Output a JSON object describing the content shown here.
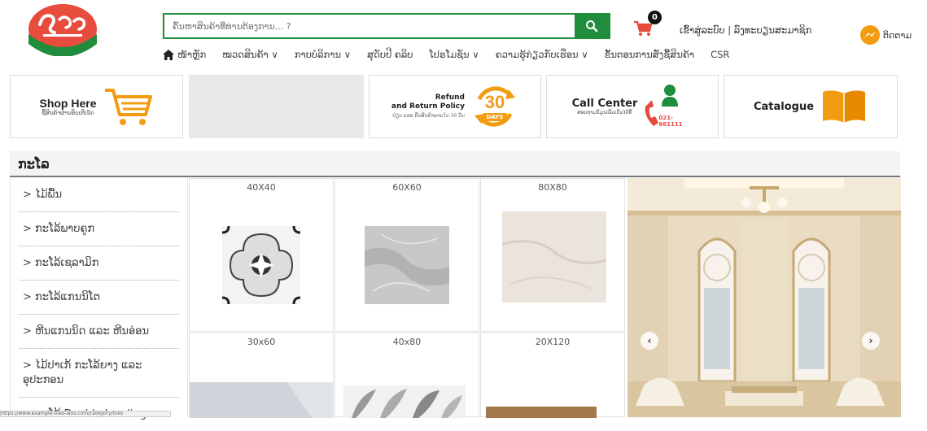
{
  "header": {
    "search": {
      "placeholder": "ຄົ້ນຫາສິນຄ້າທີ່ທ່ານຕ້ອງການ... ?"
    },
    "cart_count": "0",
    "auth_text": "ເຂົ້າສູ່ລະບົບ | ລົງທະບຽນສະມາຊິກ",
    "messenger_label": "ຕິດຕາມ"
  },
  "nav": {
    "items": [
      {
        "label": "ໜ້າຫຼັກ"
      },
      {
        "label": "ໝວດສິນຄ້າ ∨"
      },
      {
        "label": "ກາບບໍລິການ ∨"
      },
      {
        "label": "ສຸດັບປີ ຄລິບ"
      },
      {
        "label": "ໂປຣໂມຊັນ ∨"
      },
      {
        "label": "ຄວາມຮູ້ກ່ຽວກັບເຮືອນ ∨"
      },
      {
        "label": "ຂັ້ນຕອນການສັ່ງຊື້ສິນຄ້າ"
      },
      {
        "label": "CSR"
      }
    ]
  },
  "banners": {
    "shop_here": {
      "title": "Shop Here",
      "sub": "ຊື້ສິນຄ້າຜ່ານອິນເຕີເນັດ"
    },
    "refund": {
      "line1": "Refund",
      "line2": "and Return Policy",
      "sub": "ປ່ຽນ ແລະ ຄືນສິນຄ້າພາຍໃນ 30 ວັນ",
      "days_num": "30",
      "days_word": "DAYS"
    },
    "call_center": {
      "title": "Call Center",
      "sub": "ສອບຖາມຂໍ້ມູນເພີ່ມເຕີມໄດ້ທີ່",
      "phone": "021-661111"
    },
    "catalogue": {
      "title": "Catalogue"
    }
  },
  "section": {
    "title": "ກະໂລ"
  },
  "sidebar": {
    "items": [
      {
        "label": "> ໄມ້ພື້ນ"
      },
      {
        "label": "> ກະໂລ້ພາບຄູກ"
      },
      {
        "label": "> ກະໂລ້ເຊລາມິກ"
      },
      {
        "label": "> ກະໂລ້ແກນນິໂຕ"
      },
      {
        "label": "> ຫີນແກນນິດ ແລະ ຫີນອ່ອນ"
      },
      {
        "label": "> ໄມ້ປາເກ້ ກະໂລ້ຍາງ ແລະ ອຸປະກອນ"
      },
      {
        "label": "> ກະໂລ້ Double Loading"
      }
    ]
  },
  "tiles": [
    {
      "size": "40X40"
    },
    {
      "size": "60X60"
    },
    {
      "size": "80X80"
    },
    {
      "size": "30x60"
    },
    {
      "size": "40x80"
    },
    {
      "size": "20X120"
    }
  ],
  "status_text": "https://www.example-tiles-laos.com/category/tiles",
  "colors": {
    "brand_green": "#1f8d3b",
    "brand_orange": "#f39c12",
    "brand_red": "#e74c3c"
  }
}
